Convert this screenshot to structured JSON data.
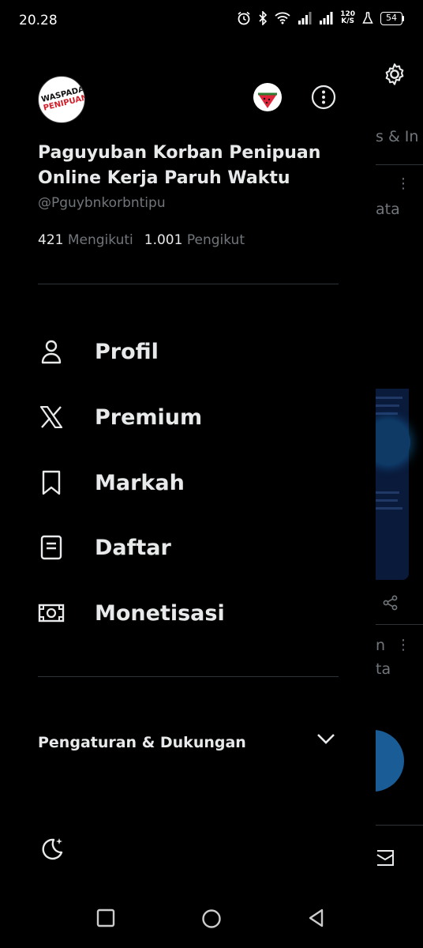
{
  "status_bar": {
    "time": "20.28",
    "net_speed_top": "120",
    "net_speed_bottom": "K/S",
    "battery": "54"
  },
  "profile": {
    "avatar_caption_line1": "WASPADA",
    "avatar_caption_line2": "PENIPUAN!!",
    "display_name": "Paguyuban Korban Penipuan Online Kerja Paruh Waktu",
    "handle": "@Pguybnkorbntipu",
    "following_count": "421",
    "following_label": "Mengikuti",
    "followers_count": "1.001",
    "followers_label": "Pengikut"
  },
  "menu": {
    "items": [
      {
        "label": "Profil",
        "icon": "person-icon"
      },
      {
        "label": "Premium",
        "icon": "x-logo-icon"
      },
      {
        "label": "Markah",
        "icon": "bookmark-icon"
      },
      {
        "label": "Daftar",
        "icon": "list-icon"
      },
      {
        "label": "Monetisasi",
        "icon": "money-icon"
      }
    ]
  },
  "settings": {
    "label": "Pengaturan & Dukungan"
  },
  "background": {
    "tab_fragment": "s & In",
    "text_fragment_1": "ata",
    "text_fragment_2": "n",
    "text_fragment_3": "ta"
  },
  "colors": {
    "background": "#000000",
    "text_primary": "#e7e9ea",
    "text_secondary": "#71767b",
    "divider": "#2f3336",
    "accent": "#1d9bf0"
  }
}
